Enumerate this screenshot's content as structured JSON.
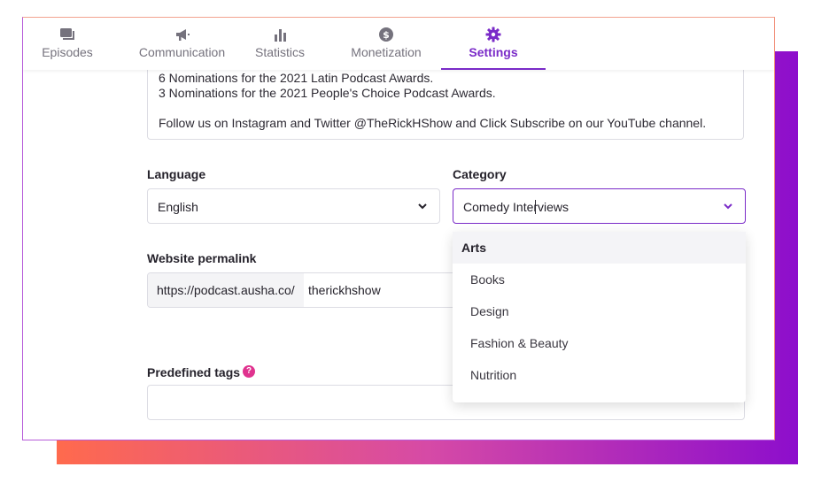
{
  "tabs": [
    {
      "label": "Episodes",
      "icon": "episodes-icon"
    },
    {
      "label": "Communication",
      "icon": "megaphone-icon"
    },
    {
      "label": "Statistics",
      "icon": "bar-chart-icon"
    },
    {
      "label": "Monetization",
      "icon": "dollar-coin-icon"
    },
    {
      "label": "Settings",
      "icon": "gear-icon",
      "active": true
    }
  ],
  "description": {
    "lines": [
      "6 Nominations for the 2021 Latin Podcast Awards.",
      "3 Nominations for the 2021 People's Choice Podcast Awards.",
      "",
      "Follow us on Instagram and Twitter @TheRickHShow and Click Subscribe on our YouTube channel."
    ]
  },
  "language": {
    "label": "Language",
    "value": "English"
  },
  "category": {
    "label": "Category",
    "value": "Comedy Interviews"
  },
  "permalink": {
    "label": "Website permalink",
    "prefix": "https://podcast.ausha.co/",
    "slug": "therickhshow"
  },
  "tags": {
    "label": "Predefined tags",
    "help": "?"
  },
  "category_dropdown": {
    "group": "Arts",
    "options": [
      "Books",
      "Design",
      "Fashion & Beauty",
      "Nutrition"
    ]
  },
  "colors": {
    "accent": "#7a2bc8",
    "help": "#e0338f",
    "gradient_start": "#ff6a4d",
    "gradient_end": "#8d0ecc"
  }
}
